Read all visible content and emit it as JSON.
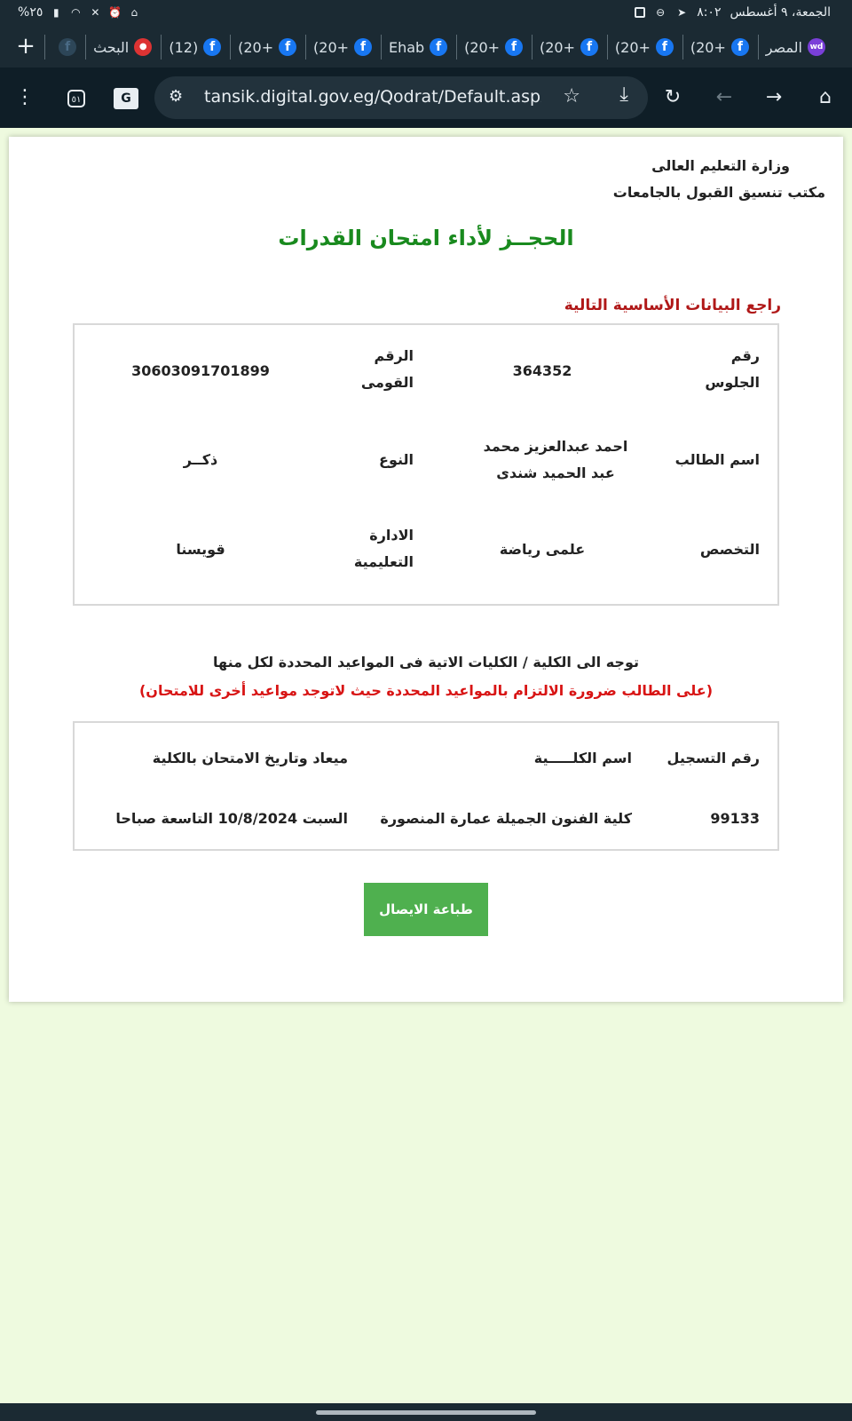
{
  "status_bar": {
    "datetime": "الجمعة، ٩ أغسطس",
    "time": "٨:٠٢",
    "battery": "%٢٥"
  },
  "tabs": [
    {
      "title": "المصر",
      "icon": "wd-icon"
    },
    {
      "title": "(20+",
      "icon": "facebook-icon"
    },
    {
      "title": "(20+",
      "icon": "facebook-icon"
    },
    {
      "title": "(20+",
      "icon": "facebook-icon"
    },
    {
      "title": "(20+",
      "icon": "facebook-icon"
    },
    {
      "title": "Ehab",
      "icon": "facebook-icon"
    },
    {
      "title": "(20+",
      "icon": "facebook-icon"
    },
    {
      "title": "(20+",
      "icon": "facebook-icon"
    },
    {
      "title": "(12)",
      "icon": "facebook-icon"
    },
    {
      "title": "البحث",
      "icon": "search-engine-icon"
    },
    {
      "title": "",
      "icon": "facebook-icon"
    }
  ],
  "address_bar": {
    "url": "tansik.digital.gov.eg/Qodrat/Default.aspx",
    "tab_count": "٥١"
  },
  "header": {
    "ministry": "وزارة التعليم العالى",
    "office": "مكتب تنسيق القبول بالجامعات",
    "title": "الحجــز لأداء امتحان القدرات",
    "review_label": "راجع البيانات الأساسية التالية"
  },
  "student_info": {
    "seat_label": "رقم الجلوس",
    "seat_value": "364352",
    "national_id_label": "الرقم القومى",
    "national_id_value": "30603091701899",
    "name_label": "اسم الطالب",
    "name_value": "احمد عبدالعزيز محمد عبد الحميد شندى",
    "gender_label": "النوع",
    "gender_value": "ذكــر",
    "specialization_label": "التخصص",
    "specialization_value": "علمى رياضة",
    "admin_label": "الادارة التعليمية",
    "admin_value": "قويسنا"
  },
  "notes": {
    "direction": "توجه الى الكلية / الكليات الاتية فى المواعيد المحددة لكل منها",
    "warning": "(على الطالب ضرورة الالتزام بالمواعيد المحددة حيث لاتوجد مواعيد أخرى للامتحان)"
  },
  "colleges_table": {
    "headers": {
      "registration": "رقم التسجيل",
      "college": "اسم الكلـــــية",
      "schedule": "ميعاد وتاريخ الامتحان بالكلية"
    },
    "rows": [
      {
        "registration": "99133",
        "college": "كلية الفنون الجميلة عمارة المنصورة",
        "schedule": "السبت 10/8/2024 التاسعة صباحا"
      }
    ]
  },
  "print_button": "طباعة الايصال",
  "colors": {
    "title_green": "#198a1e",
    "review_red": "#b01818",
    "warning_red": "#d81414",
    "button_green": "#4fb04f",
    "page_bg": "#eefadf"
  }
}
